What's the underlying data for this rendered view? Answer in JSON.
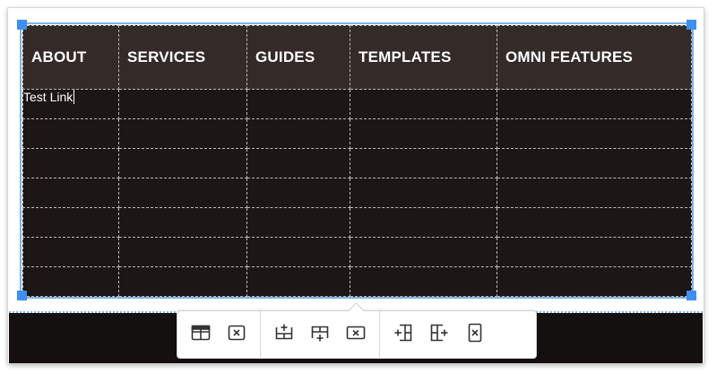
{
  "table": {
    "headers": [
      "ABOUT",
      "SERVICES",
      "GUIDES",
      "TEMPLATES",
      "OMNI FEATURES"
    ],
    "rows": [
      [
        "Test Link",
        "",
        "",
        "",
        ""
      ],
      [
        "",
        "",
        "",
        "",
        ""
      ],
      [
        "",
        "",
        "",
        "",
        ""
      ],
      [
        "",
        "",
        "",
        "",
        ""
      ],
      [
        "",
        "",
        "",
        "",
        ""
      ],
      [
        "",
        "",
        "",
        "",
        ""
      ],
      [
        "",
        "",
        "",
        "",
        ""
      ]
    ]
  },
  "toolbar": {
    "groups": [
      [
        "table-properties-icon",
        "delete-table-icon"
      ],
      [
        "insert-row-before-icon",
        "insert-row-after-icon",
        "delete-row-icon"
      ],
      [
        "insert-column-before-icon",
        "insert-column-after-icon",
        "delete-column-icon"
      ]
    ]
  },
  "colors": {
    "header_bg": "#342a28",
    "cell_bg": "#1c1616",
    "selection": "#3d8ff0",
    "page_strip": "#141010"
  }
}
